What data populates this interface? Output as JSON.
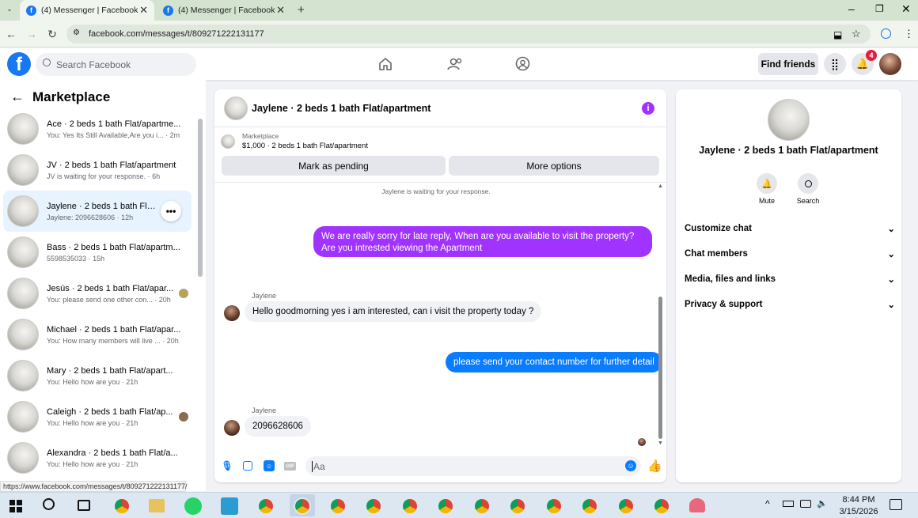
{
  "browser": {
    "tabs": [
      {
        "title": "(4) Messenger | Facebook"
      },
      {
        "title": "(4) Messenger | Facebook"
      }
    ],
    "url": "facebook.com/messages/t/809271222131177",
    "status_url": "https://www.facebook.com/messages/t/809271222131177/"
  },
  "fb": {
    "logo": "f",
    "search_placeholder": "Search Facebook",
    "find_friends": "Find friends",
    "notification_count": "4"
  },
  "sidebar": {
    "title": "Marketplace",
    "conversations": [
      {
        "name": "Ace · 2 beds 1 bath Flat/apartme...",
        "preview": "You: Yes Its Still Available,Are you i...",
        "time": "2m"
      },
      {
        "name": "JV · 2 beds 1 bath Flat/apartment",
        "preview": "JV is waiting for your response.",
        "time": "6h"
      },
      {
        "name": "Jaylene · 2 beds 1 bath Flat/a...",
        "preview": "Jaylene: 2096628606",
        "time": "12h"
      },
      {
        "name": "Bass · 2 beds 1 bath Flat/apartm...",
        "preview": "5598535033",
        "time": "15h"
      },
      {
        "name": "Jesús · 2 beds 1 bath Flat/apar...",
        "preview": "You: please send one other con...",
        "time": "20h"
      },
      {
        "name": "Michael · 2 beds 1 bath Flat/apar...",
        "preview": "You: How many members will live ...",
        "time": "20h"
      },
      {
        "name": "Mary · 2 beds 1 bath Flat/apart...",
        "preview": "You: Hello how are you",
        "time": "21h"
      },
      {
        "name": "Caleigh · 2 beds 1 bath Flat/ap...",
        "preview": "You: Hello how are you",
        "time": "21h"
      },
      {
        "name": "Alexandra · 2 beds 1 bath Flat/a...",
        "preview": "You: Hello how are you",
        "time": "21h"
      }
    ]
  },
  "chat": {
    "title": "Jaylene · 2 beds 1 bath Flat/apartment",
    "listing_label": "Marketplace",
    "listing_detail": "$1,000 · 2 beds 1 bath Flat/apartment",
    "mark_pending": "Mark as pending",
    "more_options": "More options",
    "waiting": "Jaylene is waiting for your response.",
    "messages": [
      {
        "from": "me",
        "text": "We are really sorry for late reply, When are you available to visit the property? Are you intrested viewing the Apartment"
      },
      {
        "from": "Jaylene",
        "text": "Hello goodmorning yes i am  interested, can i visit the property today ?"
      },
      {
        "from": "me",
        "text": "please send your contact number for further detail"
      },
      {
        "from": "Jaylene",
        "text": "2096628606"
      }
    ],
    "composer_placeholder": "Aa",
    "gif_label": "GIF"
  },
  "info_panel": {
    "title": "Jaylene · 2 beds 1 bath Flat/apartment",
    "mute": "Mute",
    "search": "Search",
    "sections": [
      "Customize chat",
      "Chat members",
      "Media, files and links",
      "Privacy & support"
    ]
  },
  "taskbar": {
    "time": "8:44 PM",
    "date": "3/15/2026"
  },
  "colors": {
    "brand": "#1877f2",
    "accent": "#a033ff",
    "outgoing": "#0a7cff"
  }
}
